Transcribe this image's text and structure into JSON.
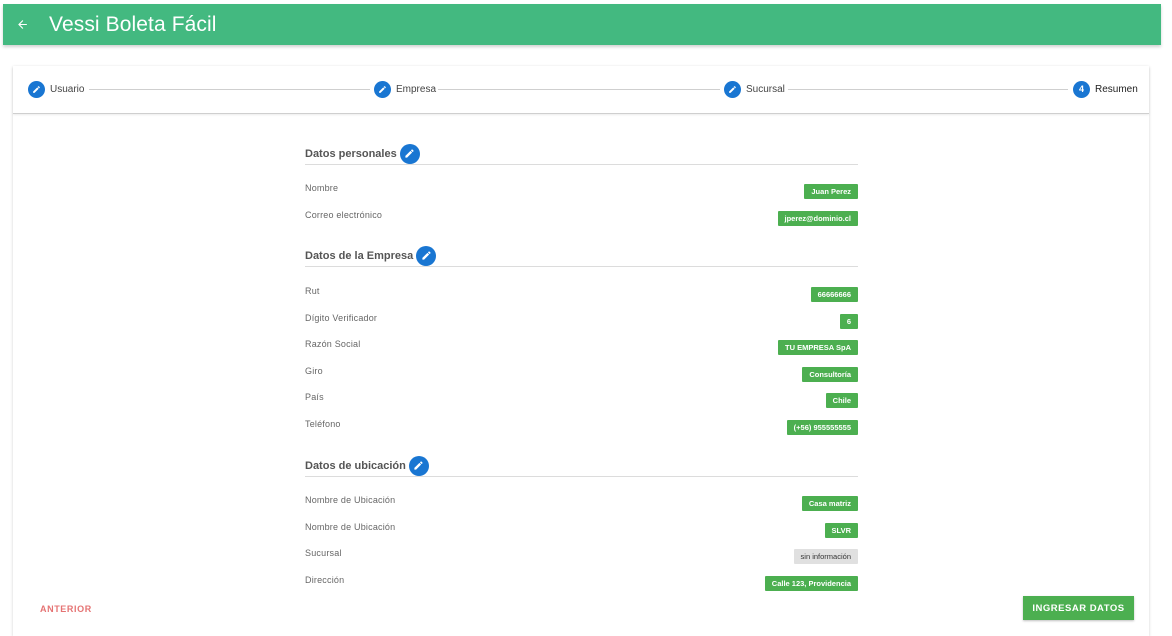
{
  "app": {
    "title": "Vessi Boleta Fácil"
  },
  "stepper": {
    "steps": [
      {
        "label": "Usuario",
        "state": "done"
      },
      {
        "label": "Empresa",
        "state": "done"
      },
      {
        "label": "Sucursal",
        "state": "done"
      },
      {
        "label": "Resumen",
        "number": "4",
        "state": "active"
      }
    ]
  },
  "sections": {
    "personal": {
      "title": "Datos personales",
      "rows": [
        {
          "label": "Nombre",
          "value": "Juan Perez"
        },
        {
          "label": "Correo electrónico",
          "value": "jperez@dominio.cl"
        }
      ]
    },
    "empresa": {
      "title": "Datos de la Empresa",
      "rows": [
        {
          "label": "Rut",
          "value": "66666666"
        },
        {
          "label": "Dígito Verificador",
          "value": "6"
        },
        {
          "label": "Razón Social",
          "value": "TU EMPRESA SpA"
        },
        {
          "label": "Giro",
          "value": "Consultoría"
        },
        {
          "label": "País",
          "value": "Chile"
        },
        {
          "label": "Teléfono",
          "value": "(+56) 955555555"
        }
      ]
    },
    "ubicacion": {
      "title": "Datos de ubicación",
      "rows": [
        {
          "label": "Nombre de Ubicación",
          "value": "Casa matriz"
        },
        {
          "label": "Nombre de Ubicación",
          "value": "SLVR"
        },
        {
          "label": "Sucursal",
          "value": "sin información"
        },
        {
          "label": "Dirección",
          "value": "Calle 123, Providencia"
        }
      ]
    }
  },
  "actions": {
    "previous": "ANTERIOR",
    "submit": "INGRESAR DATOS"
  },
  "colors": {
    "appbar": "#43b980",
    "step_icon": "#1976d2",
    "chip": "#4caf50",
    "chip_empty": "#e0e0e0",
    "previous": "#e57373"
  }
}
